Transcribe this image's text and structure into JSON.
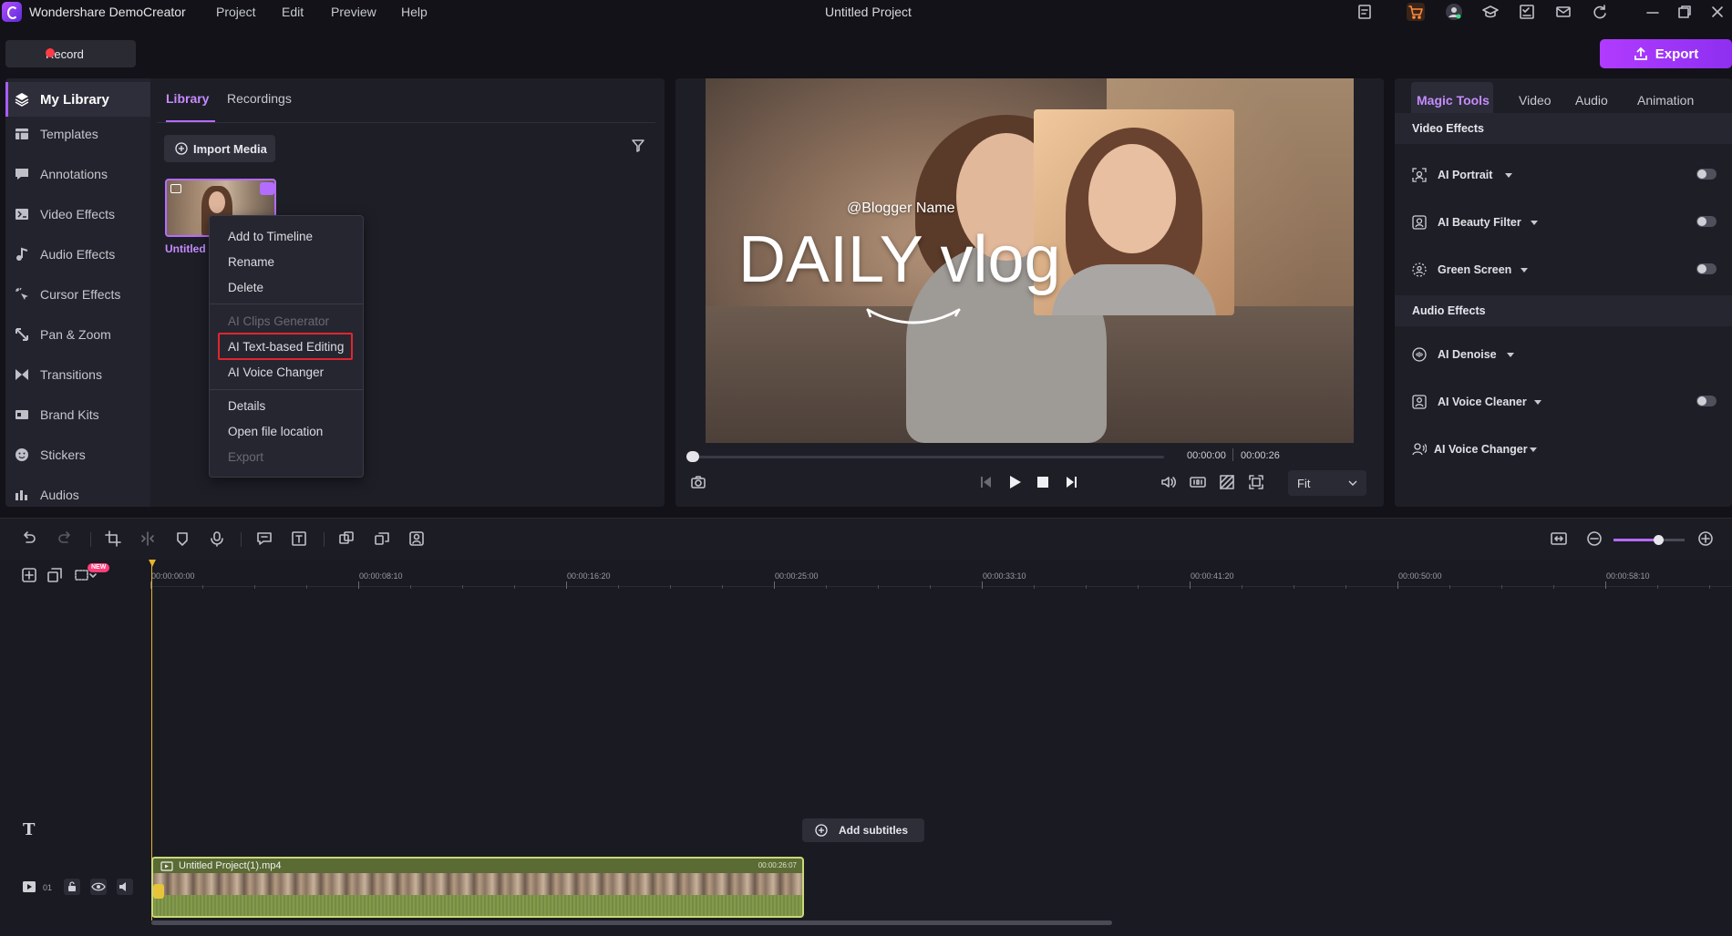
{
  "app": {
    "name": "Wondershare DemoCreator",
    "project_title": "Untitled Project"
  },
  "menu": [
    "Project",
    "Edit",
    "Preview",
    "Help"
  ],
  "record": {
    "label": "Record"
  },
  "export": {
    "label": "Export"
  },
  "sidebar": {
    "items": [
      {
        "label": "My Library",
        "icon": "layers-icon",
        "active": true
      },
      {
        "label": "Templates",
        "icon": "templates-icon"
      },
      {
        "label": "Annotations",
        "icon": "annotation-icon"
      },
      {
        "label": "Video Effects",
        "icon": "video-effects-icon"
      },
      {
        "label": "Audio Effects",
        "icon": "music-note-icon"
      },
      {
        "label": "Cursor Effects",
        "icon": "cursor-icon"
      },
      {
        "label": "Pan & Zoom",
        "icon": "pan-zoom-icon"
      },
      {
        "label": "Transitions",
        "icon": "transition-icon"
      },
      {
        "label": "Brand Kits",
        "icon": "brand-kit-icon"
      },
      {
        "label": "Stickers",
        "icon": "sticker-icon"
      },
      {
        "label": "Audios",
        "icon": "audio-icon"
      }
    ]
  },
  "library": {
    "tabs": [
      "Library",
      "Recordings"
    ],
    "import_label": "Import Media",
    "media": {
      "label": "Untitled"
    }
  },
  "context_menu": {
    "items": [
      {
        "label": "Add to Timeline",
        "enabled": true
      },
      {
        "label": "Rename",
        "enabled": true
      },
      {
        "label": "Delete",
        "enabled": true
      },
      {
        "label": "AI Clips Generator",
        "enabled": false
      },
      {
        "label": "AI Text-based Editing",
        "enabled": true,
        "highlighted": true
      },
      {
        "label": "AI Voice Changer",
        "enabled": true
      },
      {
        "label": "Details",
        "enabled": true
      },
      {
        "label": "Open file location",
        "enabled": true
      },
      {
        "label": "Export",
        "enabled": false
      }
    ]
  },
  "preview": {
    "overlay_name": "@Blogger Name",
    "overlay_title": "DAILY vlog",
    "time_current": "00:00:00",
    "time_total": "00:00:26",
    "fit_label": "Fit",
    "progress": 0
  },
  "right_panel": {
    "tabs": [
      "Magic Tools",
      "Video",
      "Audio",
      "Animation"
    ],
    "video_section": "Video Effects",
    "audio_section": "Audio Effects",
    "video_tools": [
      {
        "label": "AI Portrait",
        "icon": "portrait-icon",
        "toggle": true
      },
      {
        "label": "AI Beauty Filter",
        "icon": "beauty-icon",
        "toggle": true
      },
      {
        "label": "Green Screen",
        "icon": "green-screen-icon",
        "toggle": true
      }
    ],
    "audio_tools": [
      {
        "label": "AI Denoise",
        "icon": "denoise-icon",
        "toggle": false
      },
      {
        "label": "AI Voice Cleaner",
        "icon": "voice-cleaner-icon",
        "toggle": true
      },
      {
        "label": "AI Voice Changer",
        "icon": "voice-changer-icon",
        "toggle": false
      }
    ]
  },
  "timeline": {
    "ruler": [
      "00:00:00:00",
      "00:00:08:10",
      "00:00:16:20",
      "00:00:25:00",
      "00:00:33:10",
      "00:00:41:20",
      "00:00:50:00",
      "00:00:58:10"
    ],
    "new_badge": "NEW",
    "add_subtitles": "Add subtitles",
    "text_track_glyph": "T",
    "track_number": "01",
    "clip": {
      "name": "Untitled Project(1).mp4",
      "duration": "00:00:26:07"
    }
  }
}
